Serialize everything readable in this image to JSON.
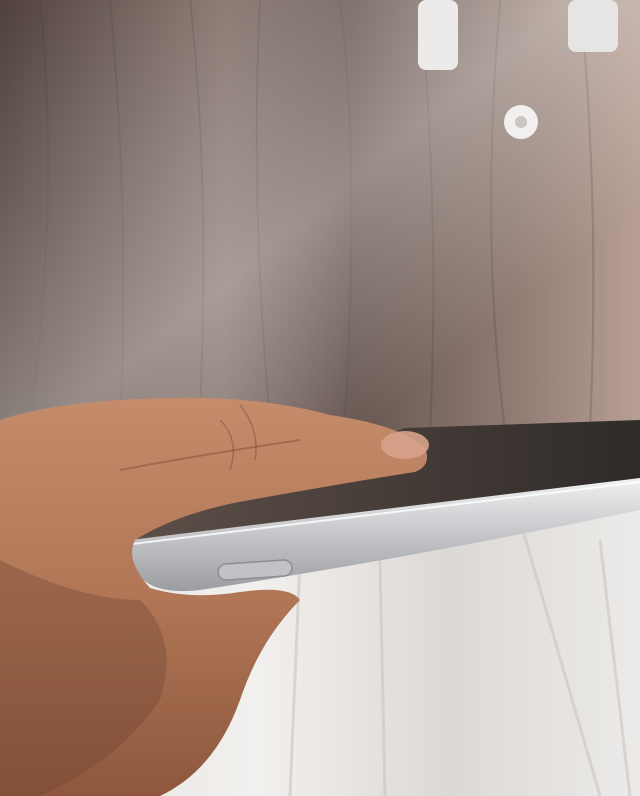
{
  "scene": {
    "subject": "hand-holding-tablet-edge",
    "colors": {
      "wood_dark": "#5b4b45",
      "wood_mid": "#7c6a62",
      "wood_light": "#a89088",
      "curtain": "#e9e6e3",
      "skin": "#b17a5c",
      "skin_shadow": "#7e4e36",
      "aluminum": "#cfd0d2",
      "screen": "#3a3633"
    }
  }
}
